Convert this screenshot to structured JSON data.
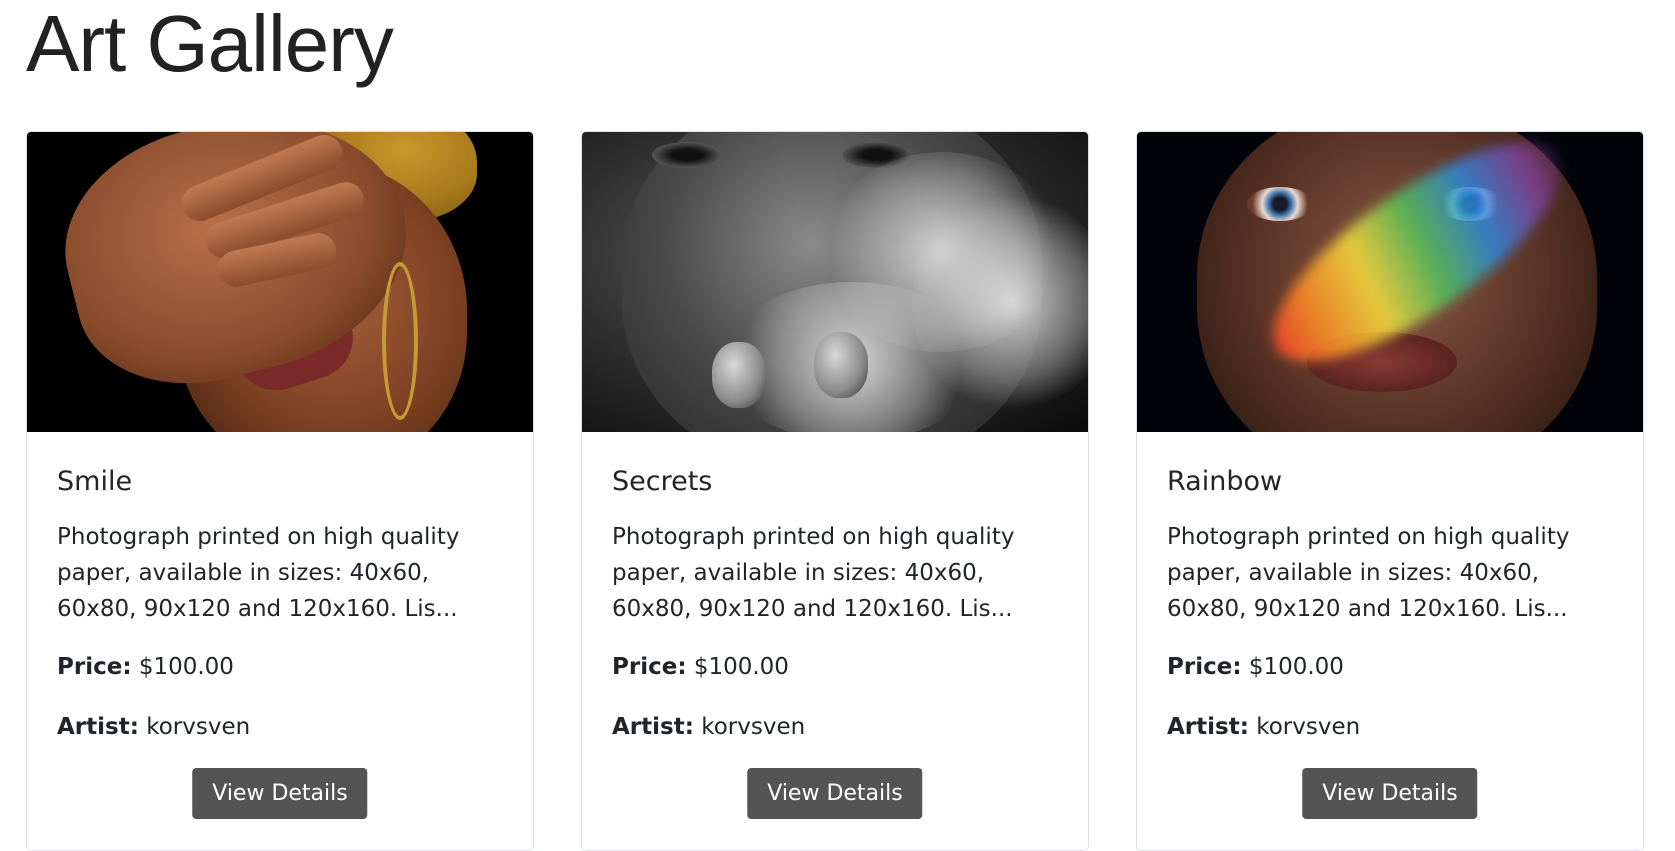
{
  "page": {
    "title": "Art Gallery"
  },
  "artworks": [
    {
      "title": "Smile",
      "description": "Photograph printed on high quality paper, available in sizes: 40x60, 60x80, 90x120 and 120x160. Lis...",
      "price_label": "Price:",
      "price": "$100.00",
      "artist_label": "Artist:",
      "artist": "korvsven",
      "button_label": "View Details"
    },
    {
      "title": "Secrets",
      "description": "Photograph printed on high quality paper, available in sizes: 40x60, 60x80, 90x120 and 120x160. Lis...",
      "price_label": "Price:",
      "price": "$100.00",
      "artist_label": "Artist:",
      "artist": "korvsven",
      "button_label": "View Details"
    },
    {
      "title": "Rainbow",
      "description": "Photograph printed on high quality paper, available in sizes: 40x60, 60x80, 90x120 and 120x160. Lis...",
      "price_label": "Price:",
      "price": "$100.00",
      "artist_label": "Artist:",
      "artist": "korvsven",
      "button_label": "View Details"
    }
  ],
  "colors": {
    "button_bg": "#545454",
    "button_text": "#ffffff",
    "card_border": "#dee2e6",
    "text": "#212529"
  }
}
